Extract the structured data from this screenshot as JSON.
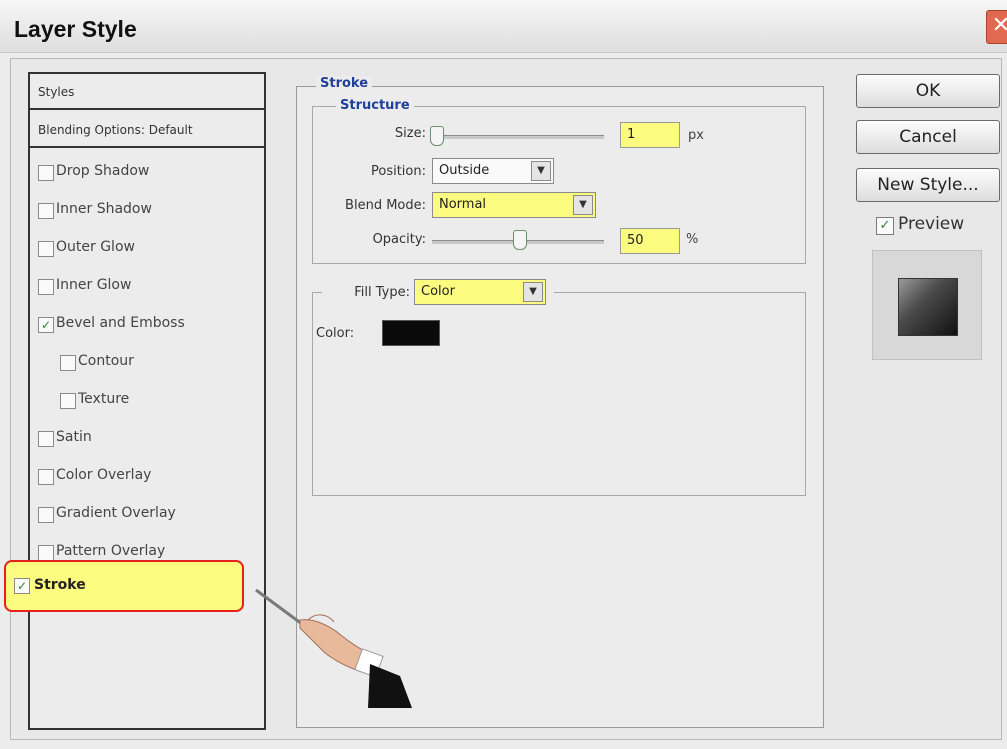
{
  "window": {
    "title": "Layer Style",
    "close_glyph": "✕"
  },
  "styles_list": {
    "header": "Styles",
    "blending": "Blending Options: Default",
    "items": [
      {
        "label": "Drop Shadow",
        "checked": false
      },
      {
        "label": "Inner Shadow",
        "checked": false
      },
      {
        "label": "Outer Glow",
        "checked": false
      },
      {
        "label": "Inner Glow",
        "checked": false
      },
      {
        "label": "Bevel and Emboss",
        "checked": true
      },
      {
        "label": "Contour",
        "checked": false
      },
      {
        "label": "Texture",
        "checked": false
      },
      {
        "label": "Satin",
        "checked": false
      },
      {
        "label": "Color Overlay",
        "checked": false
      },
      {
        "label": "Gradient Overlay",
        "checked": false
      },
      {
        "label": "Pattern Overlay",
        "checked": false
      },
      {
        "label": "Stroke",
        "checked": true,
        "selected": true
      }
    ],
    "check_glyph": "✓"
  },
  "stroke_panel": {
    "title": "Stroke",
    "structure": {
      "title": "Structure",
      "size_label": "Size:",
      "size_value": "1",
      "size_unit": "px",
      "position_label": "Position:",
      "position_value": "Outside",
      "blend_label": "Blend Mode:",
      "blend_value": "Normal",
      "opacity_label": "Opacity:",
      "opacity_value": "50",
      "opacity_unit": "%"
    },
    "fill": {
      "type_label": "Fill Type:",
      "type_value": "Color",
      "color_label": "Color:",
      "color_value": "#0a0a0a"
    },
    "dropdown_glyph": "▼"
  },
  "buttons": {
    "ok": "OK",
    "cancel": "Cancel",
    "new_style": "New Style...",
    "preview_label": "Preview",
    "preview_checked": true
  },
  "colors": {
    "highlight": "#fbfb80",
    "selection_outline": "#e8201a",
    "legend_blue": "#1f3f9a"
  }
}
